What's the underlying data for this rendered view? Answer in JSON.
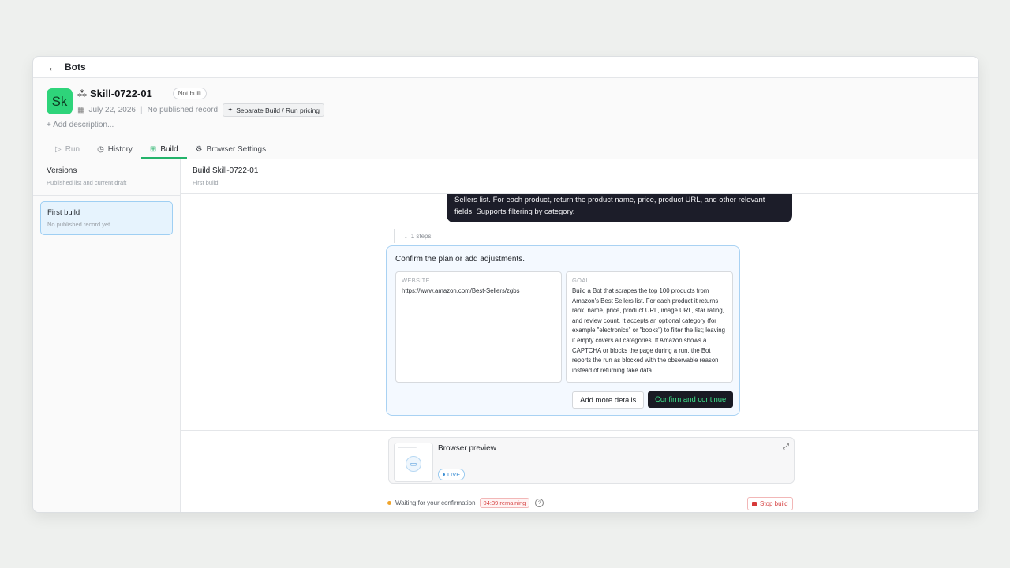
{
  "topbar": {
    "back_label": "Bots"
  },
  "header": {
    "avatar_text": "Sk",
    "title": "Skill-0722-01",
    "status_badge": "Not built",
    "date": "July 22, 2026",
    "record_status": "No published record",
    "pricing_label": "Separate Build / Run pricing",
    "add_description": "+ Add description..."
  },
  "tabs": [
    {
      "label": "Run",
      "icon": "play-icon",
      "state": "disabled"
    },
    {
      "label": "History",
      "icon": "clock-icon",
      "state": "normal"
    },
    {
      "label": "Build",
      "icon": "build-icon",
      "state": "active"
    },
    {
      "label": "Browser Settings",
      "icon": "gear-icon",
      "state": "normal"
    }
  ],
  "sidebar": {
    "title": "Versions",
    "subtitle": "Published list and current draft",
    "items": [
      {
        "name": "First build",
        "sub": "No published record yet"
      }
    ]
  },
  "main": {
    "title": "Build Skill-0722-01",
    "subtitle": "First build",
    "message_line1": "Sellers list. For each product, return the product name, price, product URL, and other relevant",
    "message_line2": "fields. Supports filtering by category.",
    "steps": "1 steps",
    "plan": {
      "prompt": "Confirm the plan or add adjustments.",
      "website_label": "WEBSITE",
      "website_value": "https://www.amazon.com/Best-Sellers/zgbs",
      "goal_label": "GOAL",
      "goal_value": "Build a Bot that scrapes the top 100 products from Amazon's Best Sellers list. For each product it returns rank, name, price, product URL, image URL, star rating, and review count. It accepts an optional category (for example \"electronics\" or \"books\") to filter the list; leaving it empty covers all categories. If Amazon shows a CAPTCHA or blocks the page during a run, the Bot reports the run as blocked with the observable reason instead of returning fake data.",
      "add_details_label": "Add more details",
      "confirm_label": "Confirm and continue"
    },
    "preview": {
      "title": "Browser preview",
      "live_label": "LIVE"
    },
    "status": {
      "text": "Waiting for your confirmation",
      "remaining": "04:39 remaining",
      "help": "?",
      "stop_label": "Stop build"
    }
  },
  "colors": {
    "accent_green": "#2ed47a",
    "active_tab": "#23b36a",
    "info_blue": "#3b8ed3",
    "danger": "#d64545"
  }
}
